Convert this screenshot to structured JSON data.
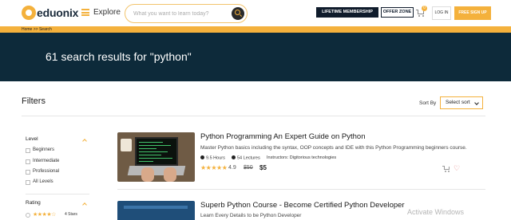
{
  "header": {
    "logo_text": "eduonix",
    "explore_label": "Explore",
    "search_placeholder": "What you want to learn today?",
    "lifetime_label": "LIFETIME MEMBERSHIP",
    "offer_label": "OFFER ZONE",
    "cart_count": "0",
    "login_label": "LOG IN",
    "signup_label": "FREE SIGN UP"
  },
  "breadcrumb": "Home >> Search",
  "hero": {
    "results_text": "61 search results for \"python\""
  },
  "filters": {
    "title": "Filters",
    "sort_by_label": "Sort By",
    "sort_selected": "Select sort",
    "level": {
      "heading": "Level",
      "options": [
        "Beginners",
        "Intermediate",
        "Professional",
        "All Levels"
      ]
    },
    "rating": {
      "heading": "Rating",
      "options": [
        {
          "stars": "★★★★☆",
          "label": "4 Stars"
        }
      ]
    }
  },
  "courses": [
    {
      "title": "Python Programming An Expert Guide on Python",
      "description": "Master Python basics including the syntax, OOP concepts and IDE with this Python Programming beginners course.",
      "hours": "9.5 Hours",
      "lectures": "54 Lectures",
      "instructors": "Instructors: Digitorious technologies",
      "stars": "★★★★★",
      "rating": "4.9",
      "old_price": "$50",
      "new_price": "$5"
    },
    {
      "title": "Superb Python Course - Become Certified Python Developer",
      "description": "Learn Every Details to be Python Developer"
    }
  ],
  "os_overlay": {
    "watermark": "Activate Windows"
  },
  "colors": {
    "accent": "#f4b13c",
    "hero_bg": "#0d2a3a",
    "dark_button": "#0f1b2b"
  }
}
